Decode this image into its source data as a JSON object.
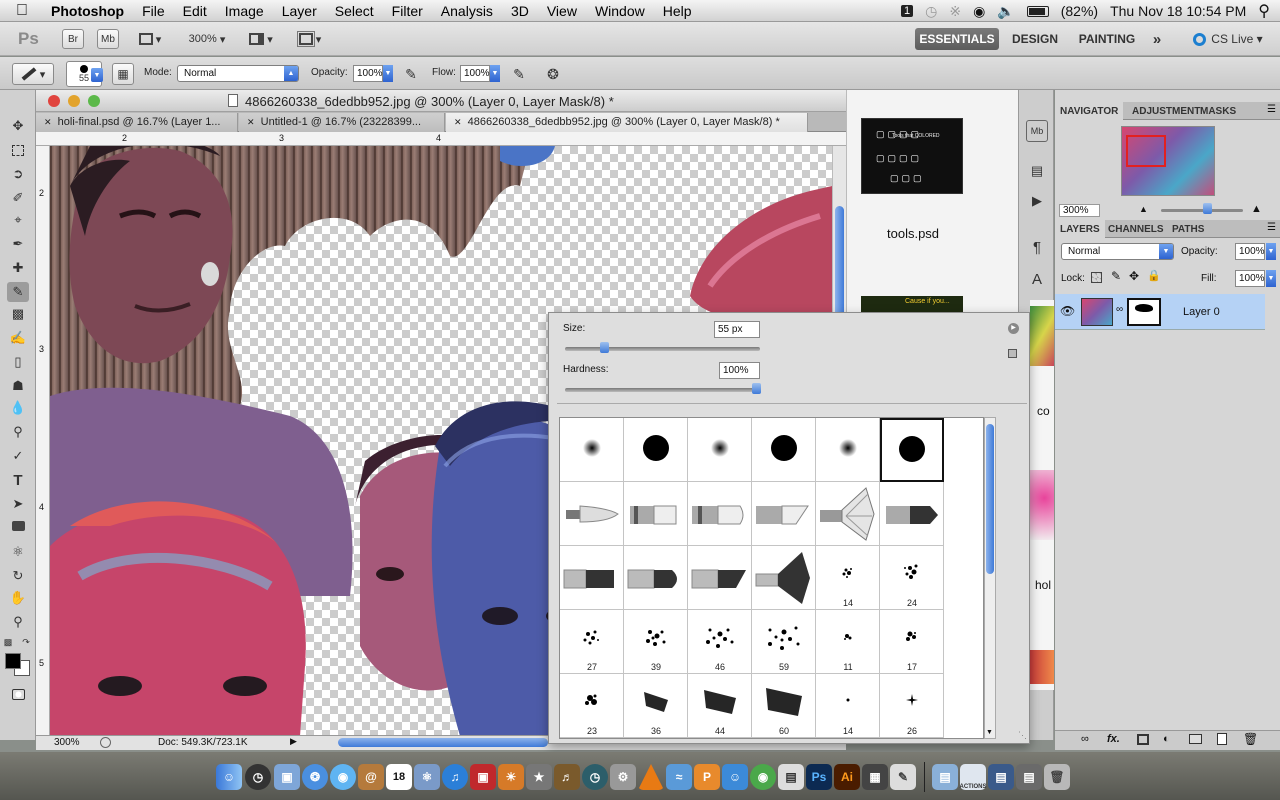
{
  "menubar": {
    "apple_icon": "apple-icon",
    "app_name": "Photoshop",
    "items": [
      "File",
      "Edit",
      "Image",
      "Layer",
      "Select",
      "Filter",
      "Analysis",
      "3D",
      "View",
      "Window",
      "Help"
    ],
    "battery": "(82%)",
    "clock": "Thu Nov 18  10:54 PM"
  },
  "appbar": {
    "ps_logo": "Ps",
    "br": "Br",
    "mb": "Mb",
    "zoom": "300%",
    "workspaces": [
      "ESSENTIALS",
      "DESIGN",
      "PAINTING"
    ],
    "more": "»",
    "cs_live": "CS Live"
  },
  "options": {
    "brush_size": "55",
    "mode_label": "Mode:",
    "mode_value": "Normal",
    "opacity_label": "Opacity:",
    "opacity_value": "100%",
    "flow_label": "Flow:",
    "flow_value": "100%"
  },
  "document": {
    "title": "4866260338_6dedbb952.jpg @ 300% (Layer 0, Layer Mask/8) *",
    "tabs": [
      {
        "label": "holi-final.psd @ 16.7% (Layer 1..."
      },
      {
        "label": "Untitled-1 @ 16.7% (23228399..."
      },
      {
        "label": "4866260338_6dedbb952.jpg @ 300% (Layer 0, Layer Mask/8) *"
      }
    ],
    "ruler_top": [
      "2",
      "3",
      "4"
    ],
    "ruler_left": [
      "2",
      "3",
      "4",
      "5"
    ],
    "status_zoom": "300%",
    "status_doc": "Doc: 549.3K/723.1K"
  },
  "brush_popup": {
    "size_label": "Size:",
    "size_value": "55 px",
    "size_level": 0.2,
    "hardness_label": "Hardness:",
    "hardness_value": "100%",
    "hardness_level": 1.0,
    "brush_numbers": {
      "r2": [
        "",
        "",
        "",
        "",
        "14",
        "24"
      ],
      "r3": [
        "27",
        "39",
        "46",
        "59",
        "11",
        "17"
      ],
      "r4": [
        "23",
        "36",
        "44",
        "60",
        "14",
        "26"
      ]
    }
  },
  "right_strip": {
    "file1": "tools.psd",
    "file2": "co",
    "file3": "hol",
    "thumb_text": "Tools that COLORED",
    "thumb2_text": "Cause if you..."
  },
  "navigator": {
    "tabs": [
      "NAVIGATOR",
      "ADJUSTMENT",
      "MASKS"
    ],
    "zoom": "300%"
  },
  "layers": {
    "tabs": [
      "LAYERS",
      "CHANNELS",
      "PATHS"
    ],
    "blend_mode": "Normal",
    "opacity_label": "Opacity:",
    "opacity_value": "100%",
    "lock_label": "Lock:",
    "fill_label": "Fill:",
    "fill_value": "100%",
    "layer_name": "Layer 0"
  },
  "dock": {
    "ps": "Ps",
    "ai": "Ai",
    "calendar_day": "18",
    "actions_label": "ACTIONS"
  },
  "colors": {
    "accent": "#2e63d0",
    "selected_layer": "#b5d2f5",
    "close": "#e0443e",
    "minimize": "#e2a32c",
    "zoom": "#5cb94a"
  }
}
